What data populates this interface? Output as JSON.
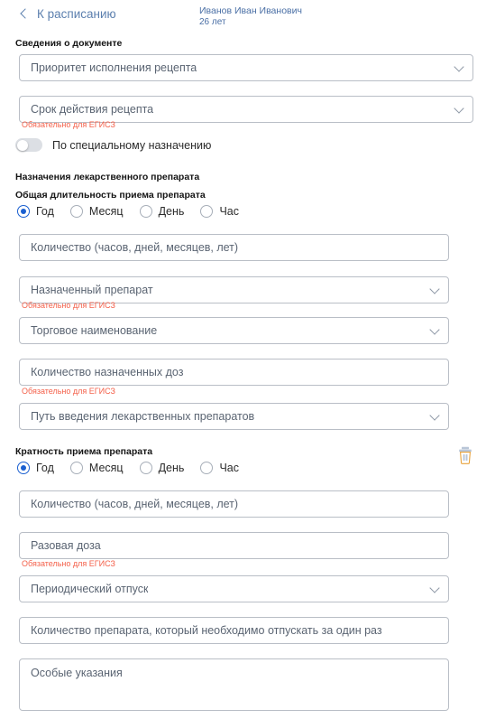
{
  "header": {
    "back_label": "К расписанию",
    "back_icon": "chevron-left-icon",
    "patient_name": "Иванов Иван Иванович",
    "patient_age": "26 лет"
  },
  "sections": {
    "document_info": "Сведения о документе",
    "prescriptions": "Назначения лекарственного препарата",
    "total_duration": "Общая длительность приема препарата",
    "frequency": "Кратность приема препарата"
  },
  "errors": {
    "egisz_required": "Обязательно для ЕГИСЗ"
  },
  "toggle": {
    "label": "По специальному назначению",
    "checked": false
  },
  "radio_options": [
    {
      "label": "Год",
      "selected": true
    },
    {
      "label": "Месяц",
      "selected": false
    },
    {
      "label": "День",
      "selected": false
    },
    {
      "label": "Час",
      "selected": false
    }
  ],
  "fields": {
    "priority": {
      "placeholder": "Приоритет исполнения рецепта",
      "value": "",
      "type": "select"
    },
    "validity": {
      "placeholder": "Срок действия рецепта",
      "value": "",
      "type": "select"
    },
    "duration_amount": {
      "placeholder": "Количество (часов, дней, месяцев, лет)",
      "value": "",
      "type": "text"
    },
    "assigned_drug": {
      "placeholder": "Назначенный препарат",
      "value": "",
      "type": "select"
    },
    "trade_name": {
      "placeholder": "Торговое наименование",
      "value": "",
      "type": "select"
    },
    "doses_count": {
      "placeholder": "Количество назначенных доз",
      "value": "",
      "type": "text"
    },
    "admin_route": {
      "placeholder": "Путь введения лекарственных препаратов",
      "value": "",
      "type": "select"
    },
    "frequency_amount": {
      "placeholder": "Количество (часов, дней, месяцев, лет)",
      "value": "",
      "type": "text"
    },
    "single_dose": {
      "placeholder": "Разовая доза",
      "value": "",
      "type": "text"
    },
    "dispense_type": {
      "placeholder": "Периодический отпуск",
      "value": "",
      "type": "select"
    },
    "dispense_amount": {
      "placeholder": "Количество препарата, который необходимо отпускать за один раз",
      "value": "",
      "type": "text"
    },
    "special_notes": {
      "placeholder": "Особые указания",
      "value": "",
      "type": "textarea"
    }
  },
  "actions": {
    "delete_icon": "trash-icon"
  },
  "colors": {
    "accent_blue": "#1a5fd0",
    "link_blue": "#5b7fae",
    "error_red": "#f4604a",
    "border_gray": "#b9bec6",
    "placeholder_gray": "#5a6472"
  }
}
